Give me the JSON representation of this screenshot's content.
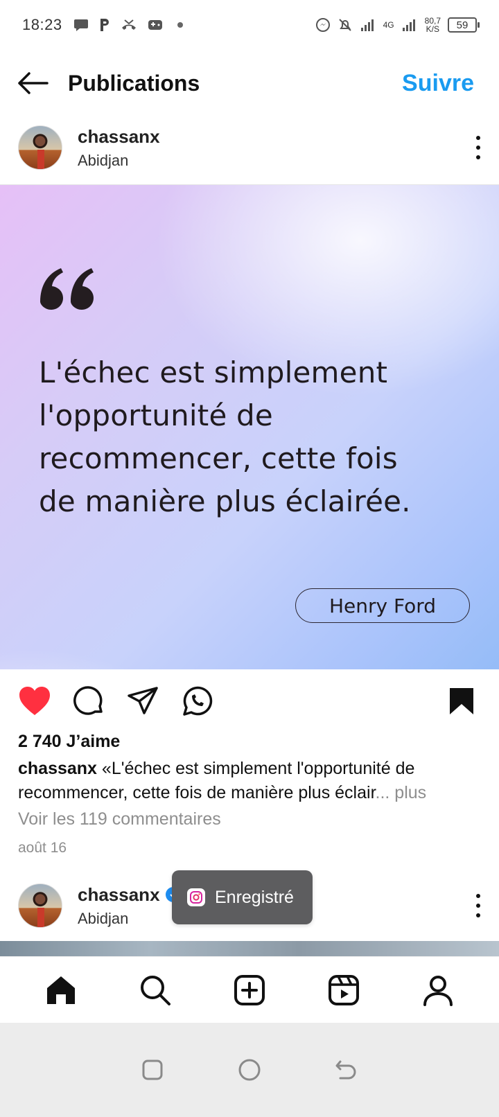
{
  "status_bar": {
    "time": "18:23",
    "network_speed_value": "80,7",
    "network_speed_unit": "K/S",
    "network_type": "4G",
    "battery": "59"
  },
  "header": {
    "title": "Publications",
    "follow_label": "Suivre"
  },
  "post": {
    "username": "chassanx",
    "location": "Abidjan",
    "quote_lines": [
      "L'échec est simplement",
      "l'opportunité de",
      "recommencer, cette fois",
      "de manière plus éclairée."
    ],
    "quote_author": "Henry Ford",
    "liked": true,
    "saved": true,
    "likes": "2 740 J’aime",
    "caption_user": "chassanx",
    "caption_text": " «L'échec est simplement l'opportunité de recommencer, cette fois de manière plus éclair",
    "caption_more": "... plus",
    "view_comments": "Voir les 119 commentaires",
    "date": "août 16"
  },
  "next_post": {
    "username": "chassanx",
    "location": "Abidjan"
  },
  "toast": {
    "label": "Enregistré"
  },
  "colors": {
    "accent_blue": "#1a9bf0",
    "like_red": "#ff3040",
    "toast_bg": "#5d5d5f"
  },
  "icons": {
    "bottom_nav": [
      "home-icon",
      "search-icon",
      "create-icon",
      "reels-icon",
      "profile-icon"
    ],
    "system_nav": [
      "recents-icon",
      "home-circle-icon",
      "back-gesture-icon"
    ]
  }
}
